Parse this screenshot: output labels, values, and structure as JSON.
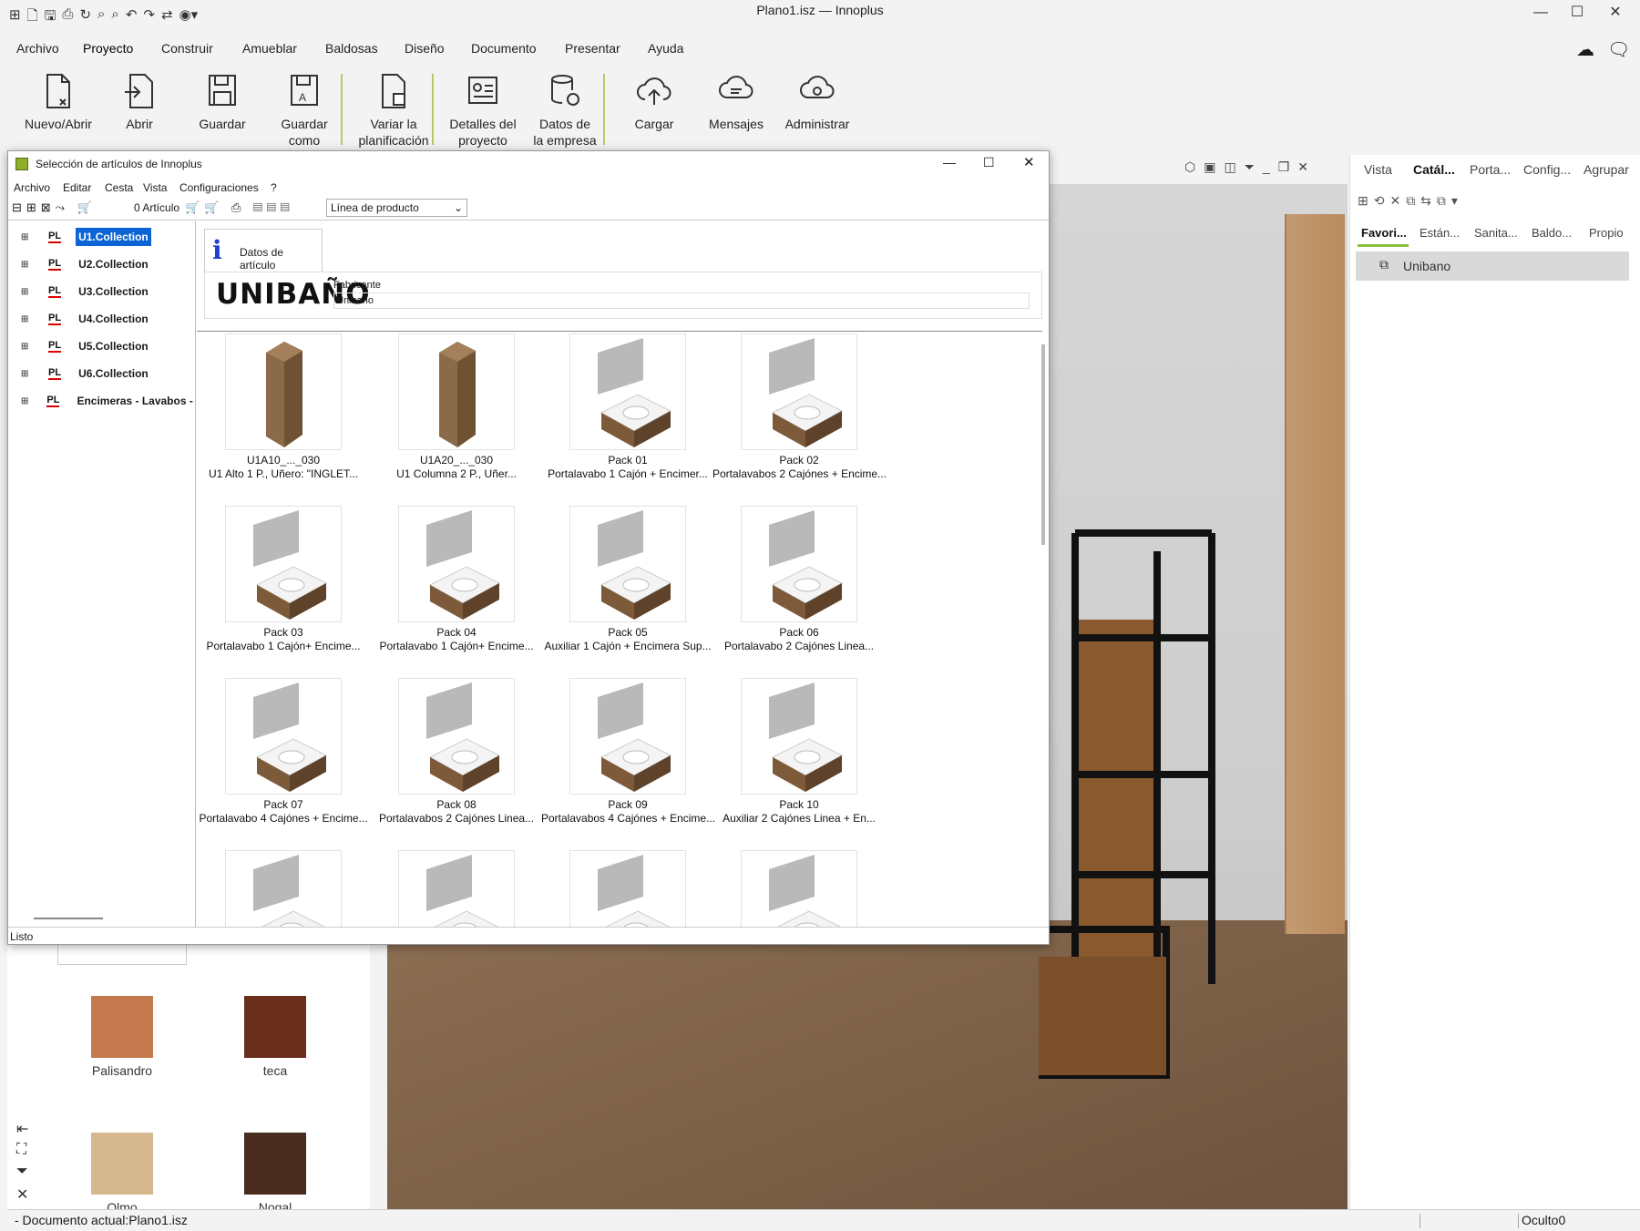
{
  "app": {
    "title": "Plano1.isz — Innoplus"
  },
  "menu": [
    "Archivo",
    "Proyecto",
    "Construir",
    "Amueblar",
    "Baldosas",
    "Diseño",
    "Documento",
    "Presentar",
    "Ayuda"
  ],
  "ribbon": [
    {
      "l1": "Nuevo/Abrir",
      "l2": ""
    },
    {
      "l1": "Abrir",
      "l2": ""
    },
    {
      "l1": "Guardar",
      "l2": ""
    },
    {
      "l1": "Guardar",
      "l2": "como"
    },
    {
      "l1": "Variar la",
      "l2": "planificación"
    },
    {
      "l1": "Detalles del",
      "l2": "proyecto"
    },
    {
      "l1": "Datos de",
      "l2": "la empresa"
    },
    {
      "l1": "Cargar",
      "l2": ""
    },
    {
      "l1": "Mensajes",
      "l2": ""
    },
    {
      "l1": "Administrar",
      "l2": ""
    }
  ],
  "right_panel": {
    "tabs": [
      "Vista",
      "Catál...",
      "Porta...",
      "Config...",
      "Agrupar"
    ],
    "subtabs": [
      "Favori...",
      "Están...",
      "Sanita...",
      "Baldo...",
      "Propio"
    ],
    "favorite": "Unibano"
  },
  "left_panel": {
    "swatches": [
      {
        "label": "Palisandro",
        "color": "#c47a4e"
      },
      {
        "label": "teca",
        "color": "#6a2e1d"
      },
      {
        "label": "Olmo",
        "color": "#d6b88e"
      },
      {
        "label": "Nogal",
        "color": "#4a2c1e"
      }
    ]
  },
  "status": {
    "doc": "- Documento actual:Plano1.isz",
    "right": "Oculto0"
  },
  "dialog": {
    "title": "Selección de artículos de Innoplus",
    "menu": [
      "Archivo",
      "Editar",
      "Cesta",
      "Vista",
      "Configuraciones",
      "?"
    ],
    "cart": "0 Artículo",
    "product_line": "Línea de producto",
    "tree": [
      "U1.Collection",
      "U2.Collection",
      "U3.Collection",
      "U4.Collection",
      "U5.Collection",
      "U6.Collection",
      "Encimeras - Lavabos - C"
    ],
    "tree_tag": "PL",
    "info_tab": "Datos de artículo",
    "brand": "UNIBAÑO",
    "manufacturer_label": "Fabricante",
    "manufacturer": "Unibano",
    "status": "Listo",
    "items": [
      {
        "code": "U1A10_..._030",
        "desc": "U1 Alto 1 P., Uñero: \"INGLET..."
      },
      {
        "code": "U1A20_..._030",
        "desc": "U1 Columna 2 P., Uñer..."
      },
      {
        "code": "Pack 01",
        "desc": "Portalavabo 1 Cajón + Encimer..."
      },
      {
        "code": "Pack 02",
        "desc": "Portalavabos 2 Cajónes + Encime..."
      },
      {
        "code": "Pack 03",
        "desc": "Portalavabo 1 Cajón+ Encime..."
      },
      {
        "code": "Pack 04",
        "desc": "Portalavabo 1 Cajón+ Encime..."
      },
      {
        "code": "Pack 05",
        "desc": "Auxiliar 1 Cajón + Encimera Sup..."
      },
      {
        "code": "Pack 06",
        "desc": "Portalavabo 2 Cajónes Linea..."
      },
      {
        "code": "Pack 07",
        "desc": "Portalavabo 4 Cajónes + Encime..."
      },
      {
        "code": "Pack 08",
        "desc": "Portalavabos 2 Cajónes Linea..."
      },
      {
        "code": "Pack 09",
        "desc": "Portalavabos 4 Cajónes + Encime..."
      },
      {
        "code": "Pack 10",
        "desc": "Auxiliar 2 Cajónes Linea + En..."
      },
      {
        "code": "",
        "desc": ""
      },
      {
        "code": "",
        "desc": ""
      },
      {
        "code": "",
        "desc": ""
      },
      {
        "code": "",
        "desc": ""
      }
    ]
  }
}
